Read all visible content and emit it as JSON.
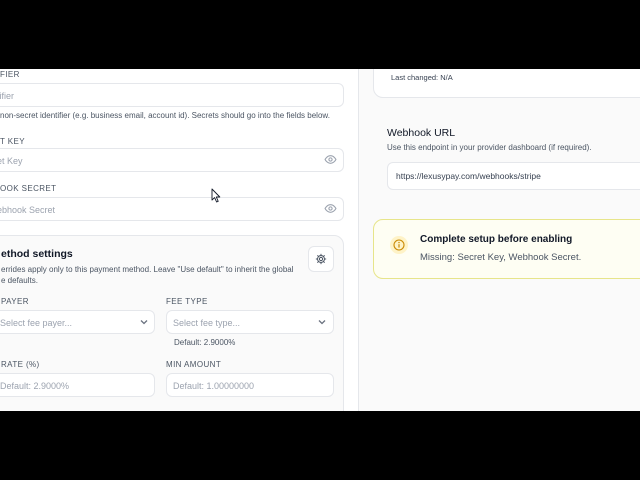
{
  "left": {
    "identifier": {
      "label": "FIER",
      "placeholder": "tifier",
      "help": "non-secret identifier (e.g. business email, account id). Secrets should go into the fields below."
    },
    "secret_key": {
      "label": "T KEY",
      "placeholder": "et Key"
    },
    "webhook_secret": {
      "label": "OOK SECRET",
      "placeholder": "ebhook Secret"
    },
    "method_settings": {
      "title": "ethod settings",
      "desc_line1": "errides apply only to this payment method. Leave \"Use default\" to inherit the global",
      "desc_line2": "e defaults.",
      "fee_payer": {
        "label": "PAYER",
        "placeholder": "Select fee payer..."
      },
      "fee_type": {
        "label": "FEE TYPE",
        "placeholder": "Select fee type...",
        "default_note": "Default: 2.9000%"
      },
      "fee_rate": {
        "label": "RATE (%)",
        "placeholder": "Default: 2.9000%"
      },
      "min_amount": {
        "label": "MIN AMOUNT",
        "placeholder": "Default: 1.00000000"
      }
    }
  },
  "right": {
    "last_changed": "Last changed: N/A",
    "webhook": {
      "title": "Webhook URL",
      "description": "Use this endpoint in your provider dashboard (if required).",
      "url": "https://lexusypay.com/webhooks/stripe"
    },
    "alert": {
      "title": "Complete setup before enabling",
      "message": "Missing: Secret Key, Webhook Secret.",
      "accent_color": "#e7e58a",
      "background": "#fefef3"
    }
  }
}
